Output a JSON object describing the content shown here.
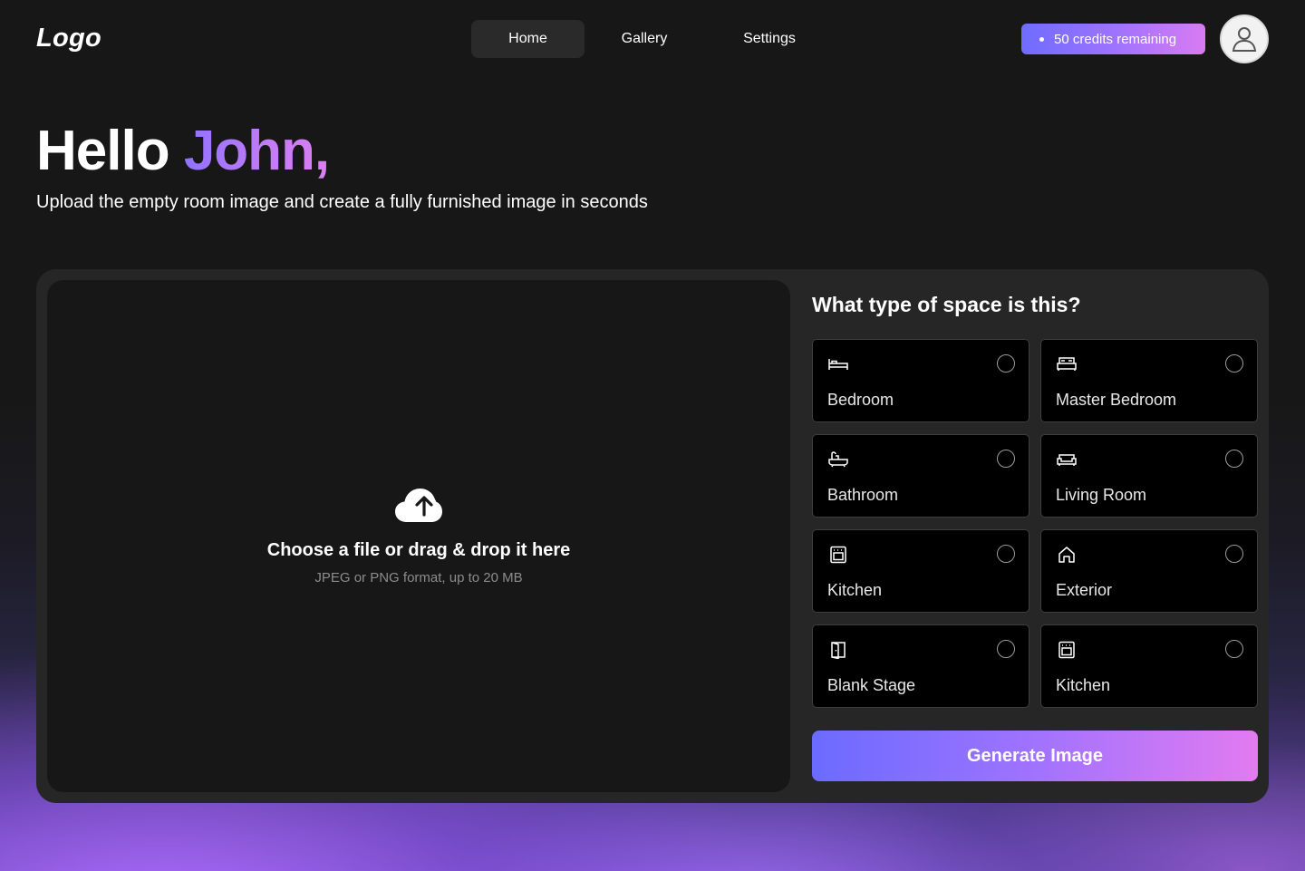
{
  "header": {
    "logo": "Logo",
    "nav": [
      {
        "label": "Home",
        "active": true
      },
      {
        "label": "Gallery",
        "active": false
      },
      {
        "label": "Settings",
        "active": false
      }
    ],
    "credits_label": "50 credits remaining",
    "avatar_icon": "user-icon"
  },
  "hero": {
    "greeting": "Hello",
    "name": "John,",
    "subtitle": "Upload the empty room image and create a fully furnished image in seconds"
  },
  "upload": {
    "icon": "cloud-upload-icon",
    "title": "Choose a file or drag & drop it here",
    "hint": "JPEG or PNG format, up to 20 MB"
  },
  "space_type": {
    "question": "What type of space is this?",
    "options": [
      {
        "label": "Bedroom",
        "icon": "bed-icon"
      },
      {
        "label": "Master Bedroom",
        "icon": "double-bed-icon"
      },
      {
        "label": "Bathroom",
        "icon": "bathtub-icon"
      },
      {
        "label": "Living Room",
        "icon": "sofa-icon"
      },
      {
        "label": "Kitchen",
        "icon": "oven-icon"
      },
      {
        "label": "Exterior",
        "icon": "house-icon"
      },
      {
        "label": "Blank Stage",
        "icon": "door-icon"
      },
      {
        "label": "Kitchen",
        "icon": "oven-icon"
      }
    ],
    "generate_label": "Generate Image"
  },
  "colors": {
    "accent_start": "#6b6bff",
    "accent_end": "#e27bf0",
    "background": "#171717",
    "panel": "#262626"
  }
}
